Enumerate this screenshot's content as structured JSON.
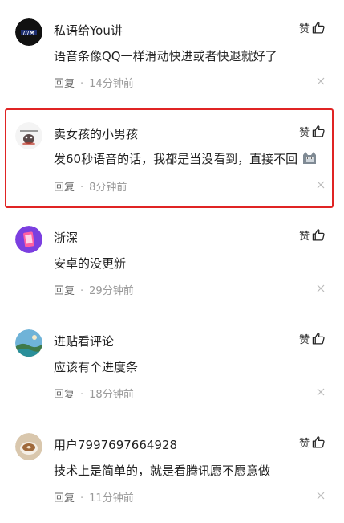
{
  "comments": [
    {
      "user": "私语给You讲",
      "text": "语音条像QQ一样滑动快进或者快退就好了",
      "reply": "回复",
      "time": "14分钟前",
      "like": "赞"
    },
    {
      "user": "卖女孩的小男孩",
      "text": "发60秒语音的话，我都是当没看到，直接不回",
      "reply": "回复",
      "time": "8分钟前",
      "like": "赞"
    },
    {
      "user": "浙深",
      "text": "安卓的没更新",
      "reply": "回复",
      "time": "29分钟前",
      "like": "赞"
    },
    {
      "user": "进贴看评论",
      "text": "应该有个进度条",
      "reply": "回复",
      "time": "18分钟前",
      "like": "赞"
    },
    {
      "user": "用户7997697664928",
      "text": "技术上是简单的，就是看腾讯愿不愿意做",
      "reply": "回复",
      "time": "11分钟前",
      "like": "赞"
    }
  ],
  "highlight_color": "#e02424"
}
